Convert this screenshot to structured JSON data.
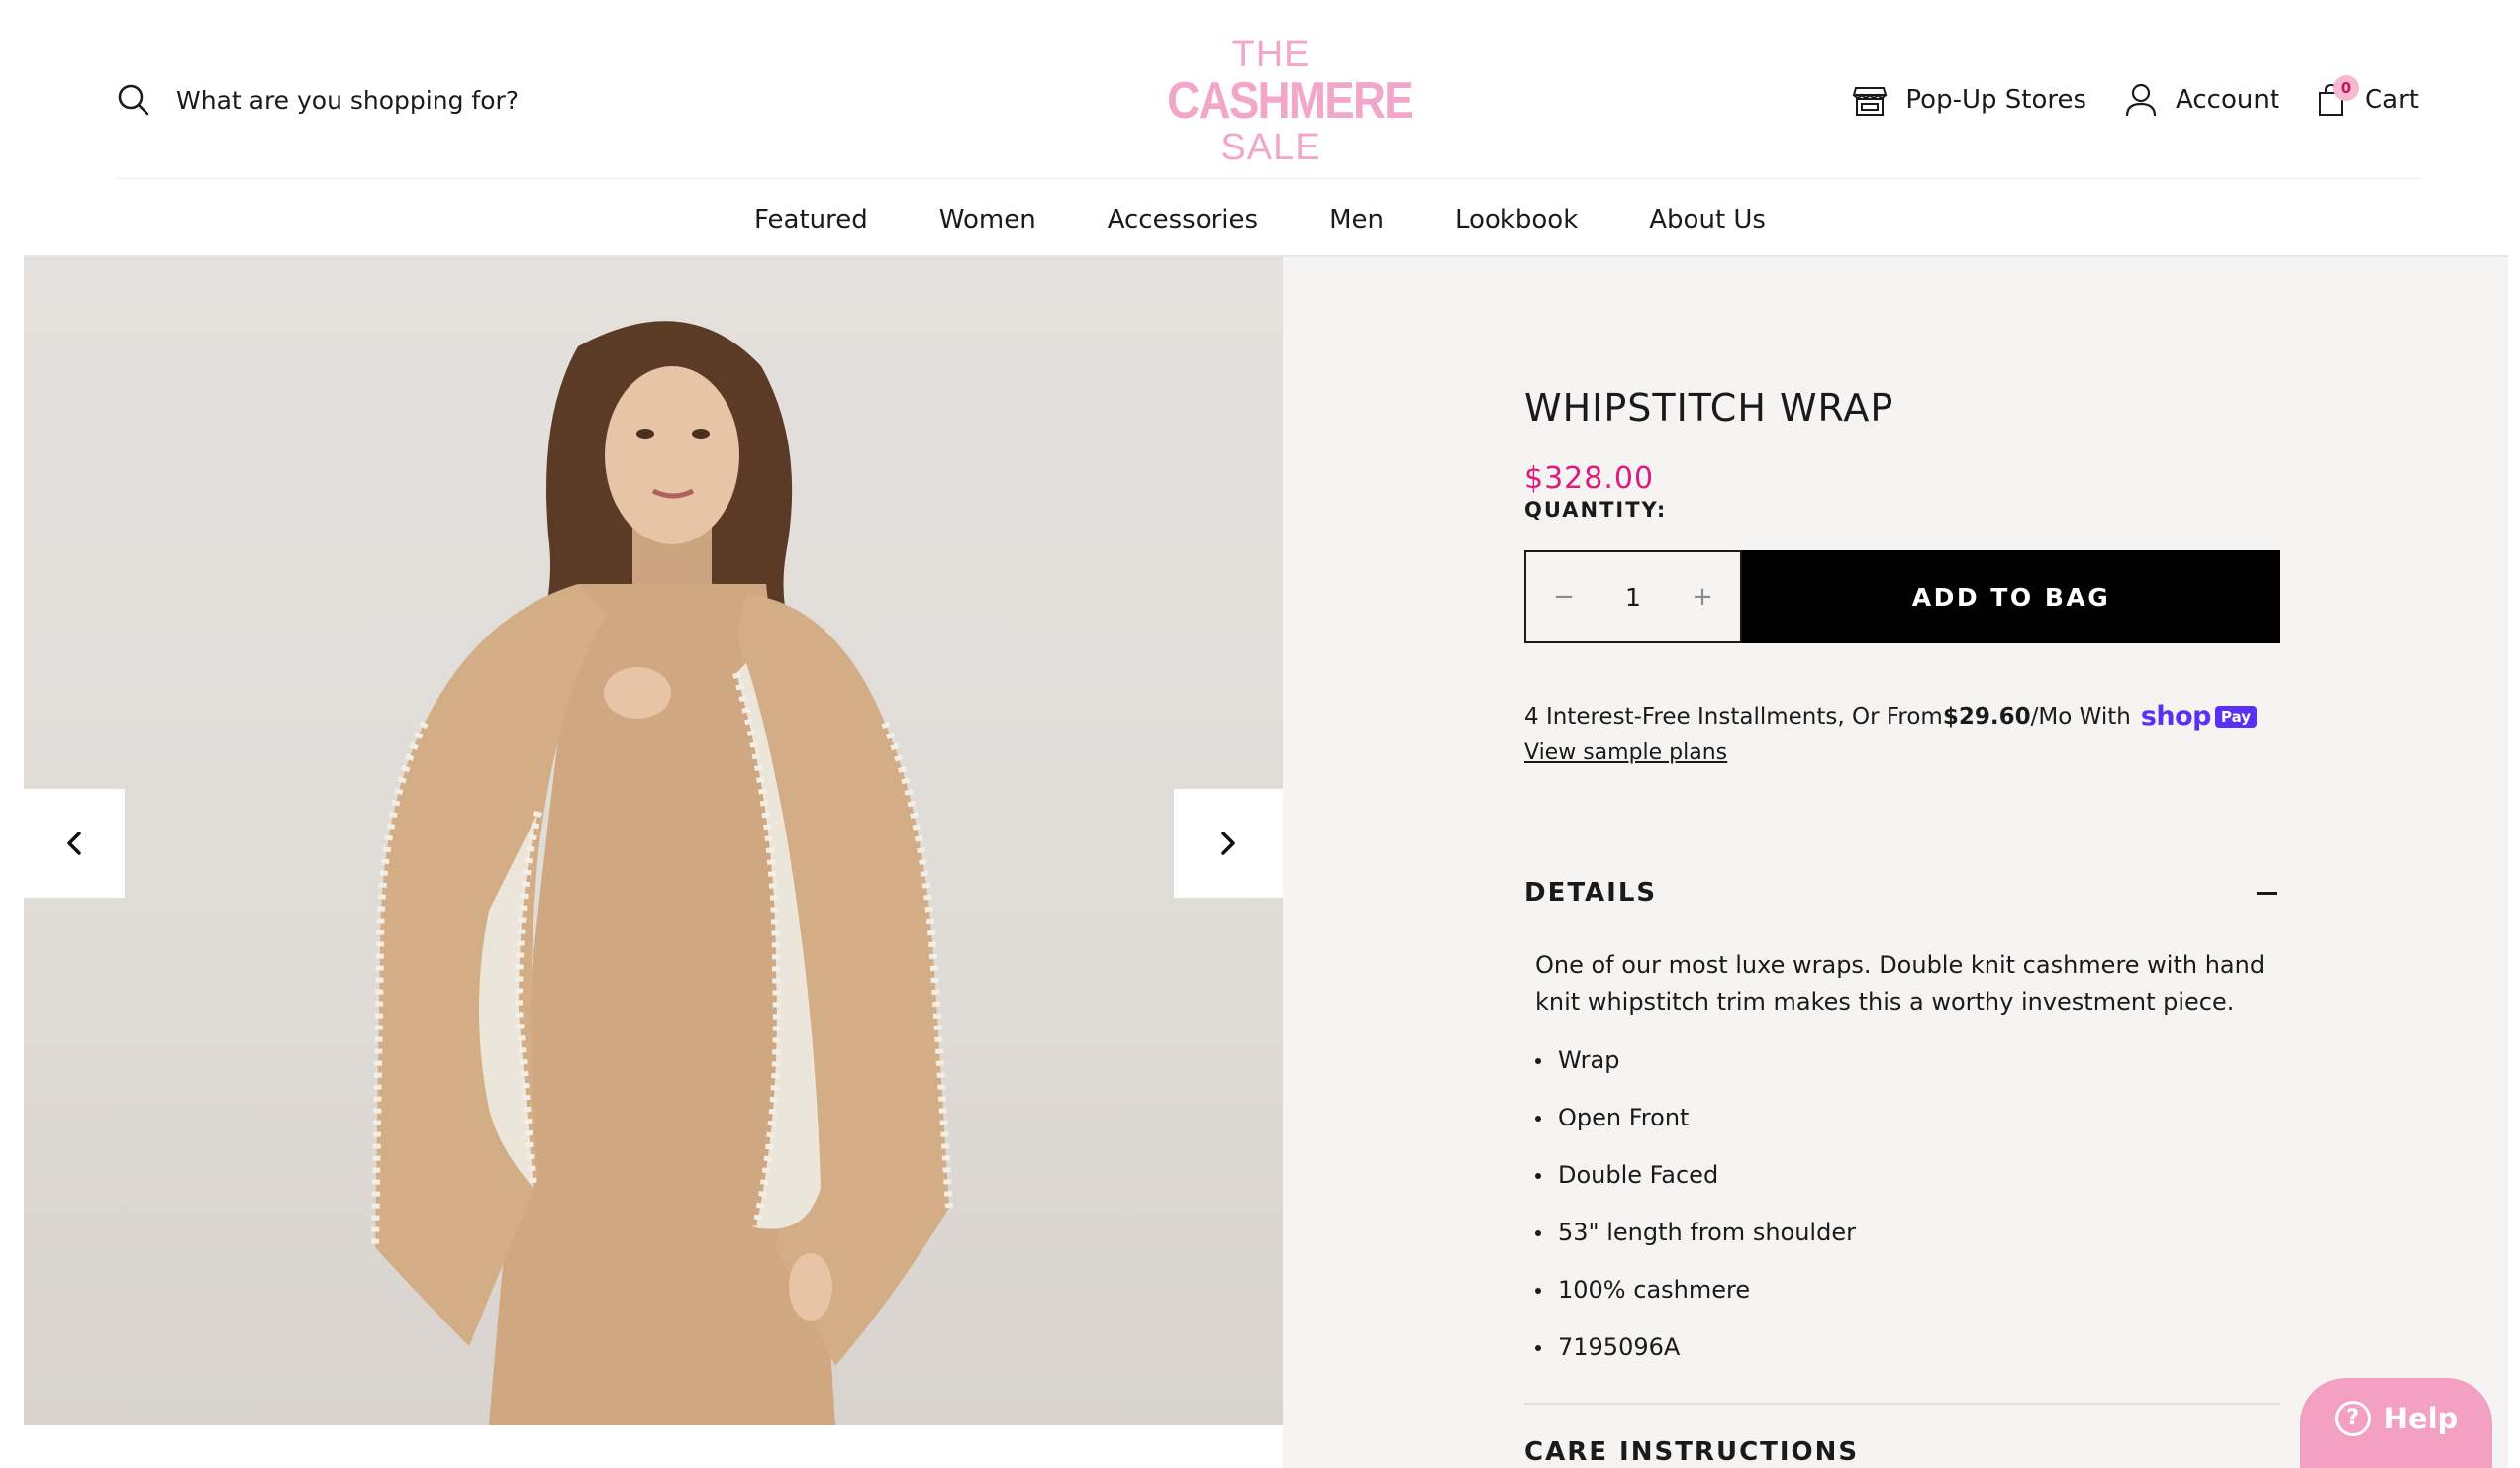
{
  "header": {
    "search_label": "What are you shopping for?",
    "logo": {
      "line1": "THE",
      "line2": "CASHMERE",
      "line3": "SALE"
    },
    "utility": {
      "popup_stores": "Pop-Up Stores",
      "account": "Account",
      "cart": "Cart",
      "cart_count": "0"
    }
  },
  "nav": {
    "items": [
      "Featured",
      "Women",
      "Accessories",
      "Men",
      "Lookbook",
      "About Us"
    ]
  },
  "gallery": {
    "prev_icon": "chevron-left-icon",
    "next_icon": "chevron-right-icon"
  },
  "product": {
    "title": "WHIPSTITCH WRAP",
    "price": "$328.00",
    "quantity_label": "QUANTITY:",
    "quantity_value": "1",
    "decrement": "−",
    "increment": "+",
    "add_to_bag": "ADD TO BAG",
    "installments": {
      "prefix": "4 Interest-Free Installments, Or From ",
      "amount": "$29.60",
      "suffix": "/Mo With",
      "shop_logo": "shop",
      "pay_badge": "Pay",
      "link": "View sample plans"
    },
    "details": {
      "heading": "DETAILS",
      "description": "One of our most luxe wraps. Double knit cashmere with hand knit whipstitch trim makes this a worthy investment piece.",
      "bullets": [
        "Wrap",
        "Open Front",
        "Double Faced",
        "53\" length from shoulder",
        "100% cashmere",
        "7195096A"
      ]
    },
    "care_heading": "CARE INSTRUCTIONS"
  },
  "help": {
    "label": "Help"
  },
  "colors": {
    "brand_pink": "#f2a6c9",
    "price_pink": "#e0197d",
    "shop_pay_purple": "#5a31f4",
    "panel_bg": "#f5f4f2"
  }
}
